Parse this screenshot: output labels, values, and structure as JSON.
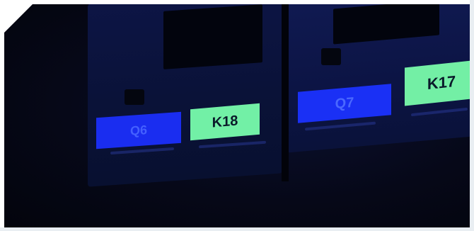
{
  "photo": {
    "labels": {
      "q6": "Q6",
      "k18": "K18",
      "q7": "Q7",
      "k17": "K17"
    },
    "colors": {
      "blue_label": "#1a2df0",
      "green_label": "#72f0a6",
      "module_panel": "#0d1545",
      "background": "#03040c"
    }
  }
}
